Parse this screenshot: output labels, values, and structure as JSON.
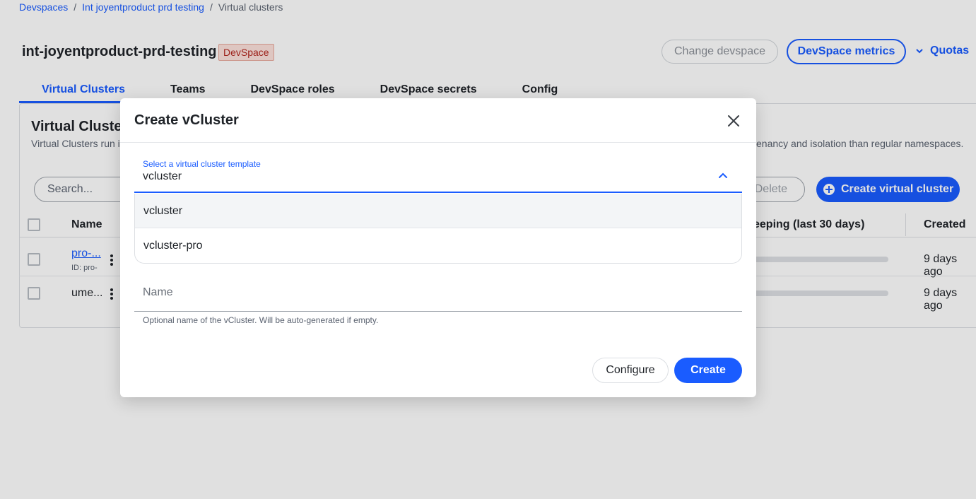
{
  "breadcrumb": {
    "items": [
      "Devspaces",
      "Int joyentproduct prd testing",
      "Virtual clusters"
    ],
    "separator": "/"
  },
  "header": {
    "title": "int-joyentproduct-prd-testing",
    "badge": "DevSpace",
    "change_devspace": "Change devspace",
    "devspace_metrics": "DevSpace metrics",
    "quotas": "Quotas"
  },
  "tabs": [
    "Virtual Clusters",
    "Teams",
    "DevSpace roles",
    "DevSpace secrets",
    "Config"
  ],
  "panel": {
    "title": "Virtual Cluster",
    "desc_left": "Virtual Clusters run i",
    "desc_right": "enancy and isolation than regular namespaces.",
    "search_placeholder": "Search...",
    "delete_label": "Delete",
    "create_label": "Create virtual cluster"
  },
  "table": {
    "headers": {
      "name": "Name",
      "sleeping": "eeping (last 30 days)",
      "created": "Created"
    },
    "rows": [
      {
        "name": "pro-...",
        "id": "ID: pro-",
        "created": "9 days ago"
      },
      {
        "name": "ume...",
        "id": "",
        "created": "9 days ago"
      }
    ]
  },
  "dialog": {
    "title": "Create vCluster",
    "template_label": "Select a virtual cluster template",
    "template_value": "vcluster",
    "options": [
      "vcluster",
      "vcluster-pro"
    ],
    "name_placeholder": "Name",
    "name_value": "",
    "name_help": "Optional name of the vCluster. Will be auto-generated if empty.",
    "configure_label": "Configure",
    "create_label": "Create"
  },
  "colors": {
    "accent": "#1a5cff",
    "badge_bg": "#fde2dc",
    "badge_text": "#b3261e"
  },
  "icons": {
    "close": "close-icon",
    "chevron": "chevron-up-icon",
    "quotas": "chevron-down-icon",
    "create": "plus-circle-icon",
    "row_menu": "kebab-icon"
  }
}
